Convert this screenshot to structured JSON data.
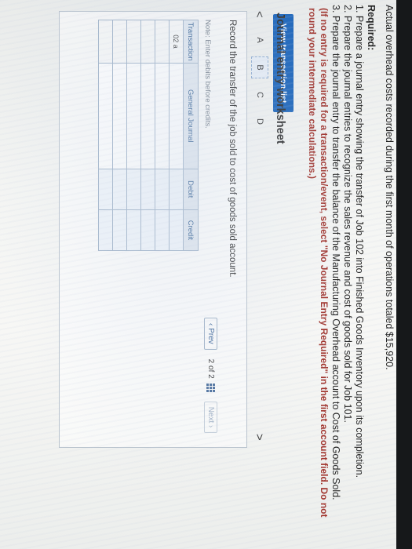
{
  "intro": "Actual overhead costs recorded during the first month of operations totaled $15,920.",
  "required": {
    "title": "Required:",
    "items": [
      "1. Prepare a journal entry showing the transfer of Job 102 into Finished Goods Inventory upon its completion.",
      "2. Prepare the journal entries to recognize the sales revenue and cost of goods sold for Job 101.",
      "3. Prepare the journal entry to transfer the balance of the Manufacturing Overhead account to Cost of Goods Sold."
    ],
    "instruction": "(If no entry is required for a transaction/event, select \"No Journal Entry Required\" in the first account field. Do not round your intermediate calculations.)"
  },
  "view_button": "View transaction list",
  "worksheet": {
    "title": "Journal entry worksheet",
    "prev_arrow": "<",
    "next_arrow": ">",
    "tabs": [
      "A",
      "B",
      "C",
      "D"
    ],
    "active_tab": "B",
    "record_text": "Record the transfer of the job sold to cost of goods sold account.",
    "note": "Note: Enter debits before credits.",
    "headers": {
      "transaction": "Transaction",
      "account": "General Journal",
      "debit": "Debit",
      "credit": "Credit"
    },
    "rows": [
      {
        "transaction": "02 a",
        "account": "",
        "debit": "",
        "credit": ""
      },
      {
        "transaction": "",
        "account": "",
        "debit": "",
        "credit": ""
      },
      {
        "transaction": "",
        "account": "",
        "debit": "",
        "credit": ""
      },
      {
        "transaction": "",
        "account": "",
        "debit": "",
        "credit": ""
      },
      {
        "transaction": "",
        "account": "",
        "debit": "",
        "credit": ""
      },
      {
        "transaction": "",
        "account": "",
        "debit": "",
        "credit": ""
      }
    ]
  },
  "pager": {
    "prev": "Prev",
    "page": "2",
    "total": "2",
    "of": "of",
    "next": "Next"
  },
  "colors": {
    "accent": "#1560b8",
    "instruction": "#a0332c",
    "header_bg": "#dfe6ee"
  }
}
